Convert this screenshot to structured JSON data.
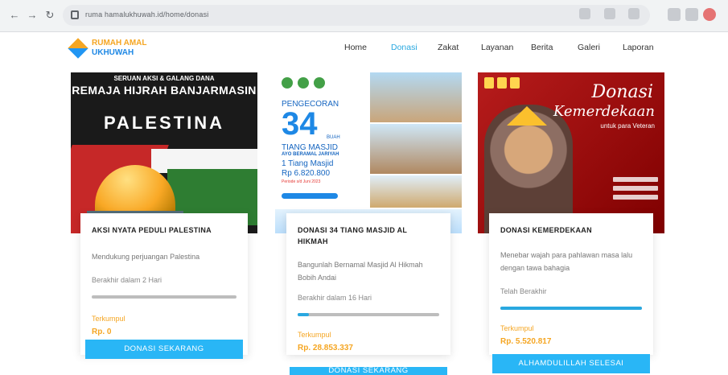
{
  "browser": {
    "url": "ruma hamalukhuwah.id/home/donasi"
  },
  "site": {
    "logo_line1": "RUMAH AMAL",
    "logo_line2": "UKHUWAH",
    "menu": [
      "Home",
      "Donasi",
      "Zakat",
      "Layanan",
      "Berita",
      "Galeri",
      "Laporan"
    ],
    "active_menu": "Donasi",
    "accent_color": "#29b6f6"
  },
  "cards": [
    {
      "image": {
        "line1": "SERUAN AKSI & GALANG DANA",
        "line2": "REMAJA HIJRAH BANJARMASIN",
        "word": "PALESTINA"
      },
      "title": "AKSI NYATA PEDULI PALESTINA",
      "desc": "Mendukung perjuangan Palestina",
      "ends": "Berakhir dalam 2 Hari",
      "progress": 0,
      "label": "Terkumpul",
      "amount": "Rp. 0",
      "button": "DONASI SEKARANG"
    },
    {
      "image": {
        "line1": "PENGECORAN",
        "number": "34",
        "unit": "BUAH",
        "line2": "TIANG MASJID",
        "line3": "AYO BERAMAL JARIYAH",
        "line4": "1 Tiang Masjid",
        "line5": "Rp 6.820.800",
        "line6": "Periode s/d Juni 2023"
      },
      "title": "DONASI 34 TIANG MASJID AL HIKMAH",
      "desc": "Bangunlah Bernamal Masjid Al Hikmah Bobih Andai",
      "ends": "Berakhir dalam 16 Hari",
      "progress": 0.08,
      "label": "Terkumpul",
      "amount": "Rp. 28.853.337",
      "button": "DONASI SEKARANG"
    },
    {
      "image": {
        "line1": "Donasi",
        "line2": "Kemerdekaan",
        "line3": "untuk para Veteran"
      },
      "title": "DONASI KEMERDEKAAN",
      "desc": "Menebar wajah para pahlawan masa lalu dengan tawa bahagia",
      "ends": "Telah Berakhir",
      "progress": 1,
      "label": "Terkumpul",
      "amount": "Rp. 5.520.817",
      "button": "ALHAMDULILLAH SELESAI"
    }
  ]
}
